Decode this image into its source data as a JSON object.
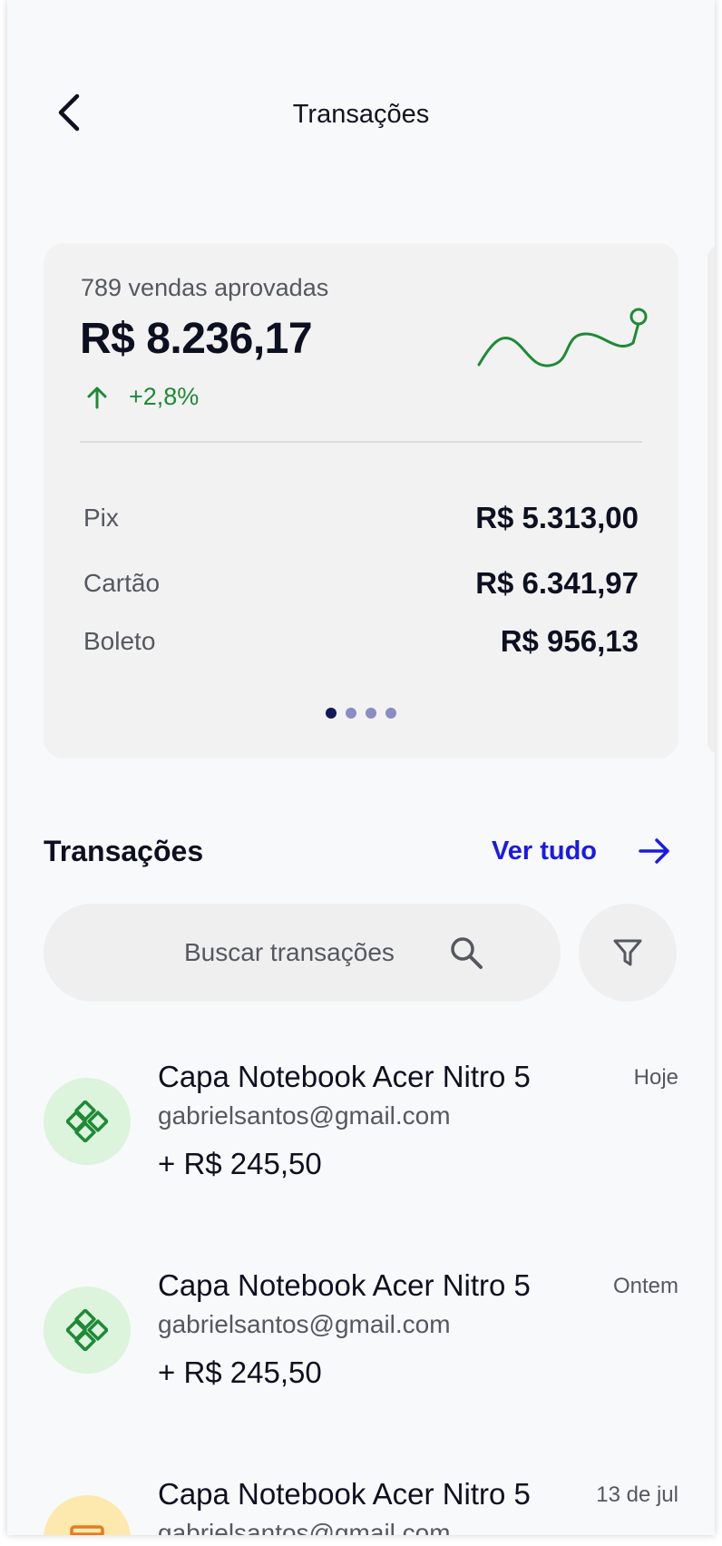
{
  "header": {
    "title": "Transações",
    "back_icon": "chevron-left-icon"
  },
  "summary_card": {
    "approved_sales": "789 vendas aprovadas",
    "total": "R$ 8.236,17",
    "growth": "+2,8%",
    "growth_color": "#1e8a36",
    "breakdown": [
      {
        "label": "Pix",
        "value": "R$ 5.313,00"
      },
      {
        "label": "Cartão",
        "value": "R$ 6.341,97"
      },
      {
        "label": "Boleto",
        "value": "R$ 956,13"
      }
    ],
    "pagination": {
      "pages": 4,
      "active": 1
    }
  },
  "transactions_section": {
    "title": "Transações",
    "see_all": "Ver tudo",
    "see_all_color": "#1a1ae6",
    "search_placeholder": "Buscar transações",
    "search_icon": "search-icon",
    "filter_icon": "filter-icon"
  },
  "transactions": [
    {
      "title": "Capa Notebook Acer Nitro 5",
      "email": "gabrielsantos@gmail.com",
      "amount": "+ R$ 245,50",
      "date": "Hoje",
      "icon": "pix-icon",
      "icon_color": "#1e8a36"
    },
    {
      "title": "Capa Notebook Acer Nitro 5",
      "email": "gabrielsantos@gmail.com",
      "amount": "+ R$ 245,50",
      "date": "Ontem",
      "icon": "pix-icon",
      "icon_color": "#1e8a36"
    },
    {
      "title": "Capa Notebook Acer Nitro 5",
      "email": "gabrielsantos@gmail.com",
      "amount": "",
      "date": "13 de jul",
      "icon": "boleto-icon",
      "icon_color": "#e87a1e"
    }
  ]
}
